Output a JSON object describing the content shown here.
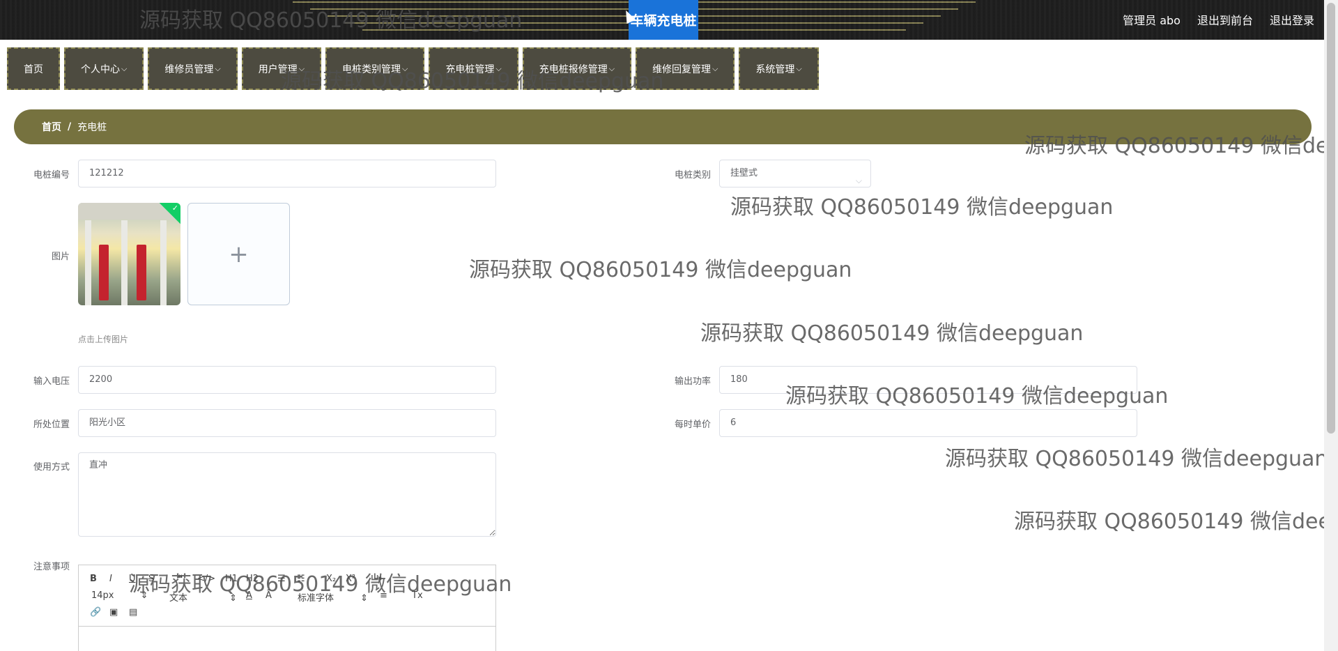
{
  "header": {
    "title": "车辆充电桩",
    "user": "管理员 abo",
    "to_front": "退出到前台",
    "logout": "退出登录"
  },
  "nav": [
    {
      "label": "首页",
      "has_dropdown": false
    },
    {
      "label": "个人中心",
      "has_dropdown": true
    },
    {
      "label": "维修员管理",
      "has_dropdown": true
    },
    {
      "label": "用户管理",
      "has_dropdown": true
    },
    {
      "label": "电桩类别管理",
      "has_dropdown": true
    },
    {
      "label": "充电桩管理",
      "has_dropdown": true
    },
    {
      "label": "充电桩报修管理",
      "has_dropdown": true
    },
    {
      "label": "维修回复管理",
      "has_dropdown": true
    },
    {
      "label": "系统管理",
      "has_dropdown": true
    }
  ],
  "breadcrumb": {
    "home": "首页",
    "separator": "/",
    "current": "充电桩"
  },
  "form": {
    "pile_no": {
      "label": "电桩编号",
      "value": "121212"
    },
    "pile_type": {
      "label": "电桩类别",
      "value": "挂壁式"
    },
    "image": {
      "label": "图片",
      "hint": "点击上传图片",
      "add_symbol": "+",
      "check_symbol": "✓"
    },
    "input_voltage": {
      "label": "输入电压",
      "value": "2200"
    },
    "output_power": {
      "label": "输出功率",
      "value": "180"
    },
    "location": {
      "label": "所处位置",
      "value": "阳光小区"
    },
    "unit_price": {
      "label": "每时单价",
      "value": "6"
    },
    "usage": {
      "label": "使用方式",
      "value": "直冲"
    },
    "notes": {
      "label": "注意事项"
    }
  },
  "editor": {
    "bold": "B",
    "italic": "I",
    "underline": "U",
    "strike": "S",
    "blockquote": "❝",
    "code": "</>",
    "h1": "H1",
    "h2": "H2",
    "ordered_list": "☰",
    "bullet_list": "☷",
    "subscript": "X₂",
    "superscript": "X²",
    "indent_in": "⇥",
    "indent_out": "⇤",
    "font_size": "14px",
    "block_format": "文本",
    "font_family": "标准字体",
    "color": "A",
    "background": "Ā",
    "align": "≡",
    "clear_format": "Tx",
    "link": "🔗",
    "image": "▣",
    "video": "▤"
  },
  "watermark": "源码获取 QQ86050149 微信deepguan",
  "colors": {
    "header_bg": "#1f1f1f",
    "title_bg": "#1a73d9",
    "nav_bg": "#4d4b40",
    "nav_border": "#8e8a52",
    "breadcrumb_bg": "#76723f",
    "success": "#13ce66"
  }
}
